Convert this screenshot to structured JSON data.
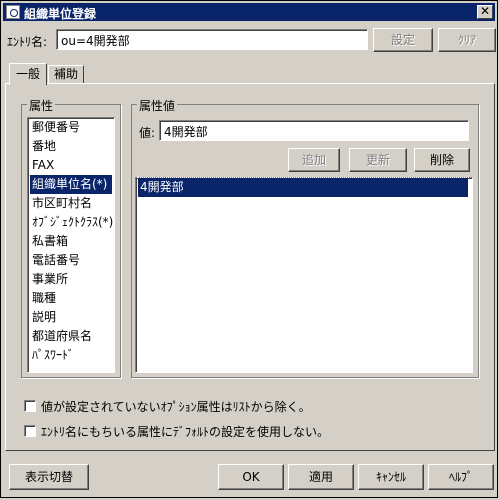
{
  "window": {
    "title": "組織単位登録",
    "close": "✕"
  },
  "entry": {
    "label": "ｴﾝﾄﾘ名:",
    "value": "ou=4開発部",
    "set_label": "設定",
    "clear_label": "ｸﾘｱ"
  },
  "tabs": [
    {
      "label": "一般"
    },
    {
      "label": "補助"
    }
  ],
  "attributes": {
    "title": "属性",
    "items": [
      "郵便番号",
      "番地",
      "FAX",
      "組織単位名(*)",
      "市区町村名",
      "ｵﾌﾞｼﾞｪｸﾄｸﾗｽ(*)",
      "私書箱",
      "電話番号",
      "事業所",
      "職種",
      "説明",
      "都道府県名",
      "ﾊﾟｽﾜｰﾄﾞ"
    ],
    "selected": "組織単位名(*)"
  },
  "values": {
    "title": "属性値",
    "value_label": "値:",
    "value": "4開発部",
    "add_label": "追加",
    "update_label": "更新",
    "delete_label": "削除",
    "items": [
      "4開発部"
    ],
    "selected": "4開発部"
  },
  "options": {
    "exclude_unset": "値が設定されていないｵﾌﾟｼｮﾝ属性はﾘｽﾄから除く。",
    "no_default": "ｴﾝﾄﾘ名にもちいる属性にﾃﾞﾌｫﾙﾄの設定を使用しない。"
  },
  "footer": {
    "toggle_label": "表示切替",
    "ok_label": "OK",
    "apply_label": "適用",
    "cancel_label": "ｷｬﾝｾﾙ",
    "help_label": "ﾍﾙﾌﾟ"
  }
}
